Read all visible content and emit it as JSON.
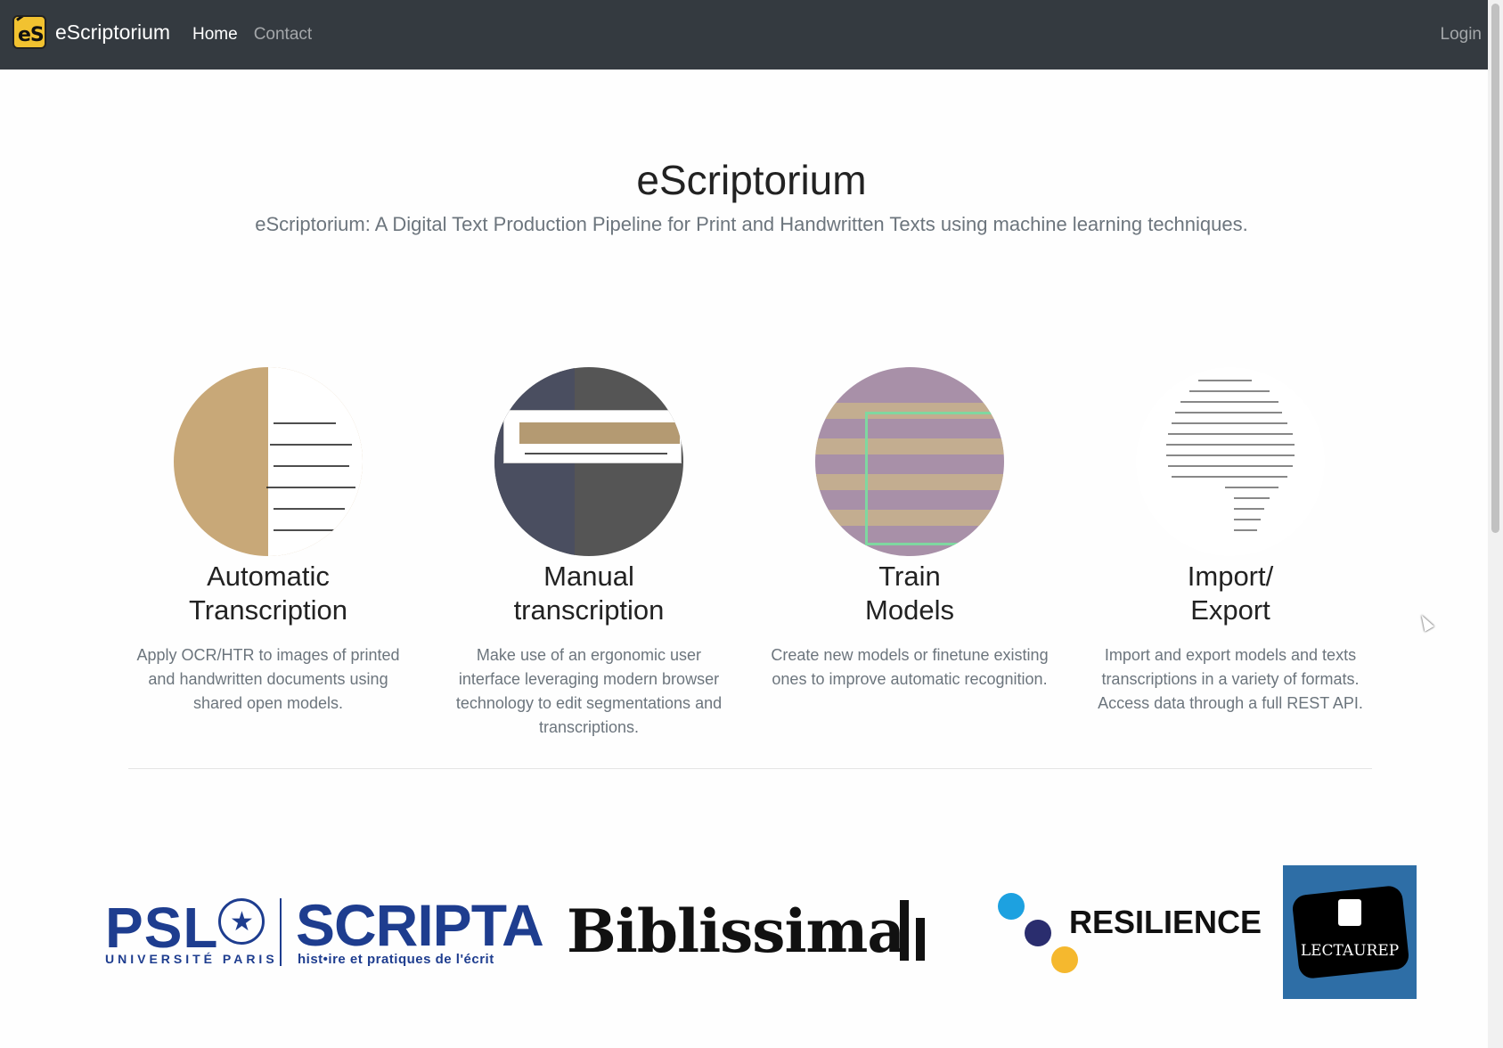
{
  "navbar": {
    "brand_logo_text": "eS",
    "brand_name": "eScriptorium",
    "links": [
      {
        "label": "Home"
      },
      {
        "label": "Contact"
      }
    ],
    "login_label": "Login"
  },
  "hero": {
    "title": "eScriptorium",
    "subtitle": "eScriptorium: A Digital Text Production Pipeline for Print and Handwritten Texts using machine learning techniques."
  },
  "features": [
    {
      "title_line1": "Automatic",
      "title_line2": "Transcription",
      "description": "Apply OCR/HTR to images of printed and handwritten documents using shared open models."
    },
    {
      "title_line1": "Manual",
      "title_line2": "transcription",
      "description": "Make use of an ergonomic user interface leveraging modern browser technology to edit segmentations and transcriptions."
    },
    {
      "title_line1": "Train",
      "title_line2": "Models",
      "description": "Create new models or finetune existing ones to improve automatic recognition."
    },
    {
      "title_line1": "Import/",
      "title_line2": "Export",
      "description": "Import and export models and texts transcriptions in a variety of formats. Access data through a full REST API."
    }
  ],
  "partners": {
    "psl_word": "PSL",
    "psl_univ": "UNIVERSITÉ PARIS",
    "scripta_word": "SCRIPTA",
    "scripta_sub": "hist•ire et pratiques de l'écrit",
    "biblissima": "Biblissima",
    "resilience": "RESILIENCE",
    "lectaurep": "LECTAUREP"
  },
  "colors": {
    "navbar_bg": "#343a40",
    "psl_blue": "#1e3d8f",
    "lectaurep_bg": "#2e6ea6"
  }
}
